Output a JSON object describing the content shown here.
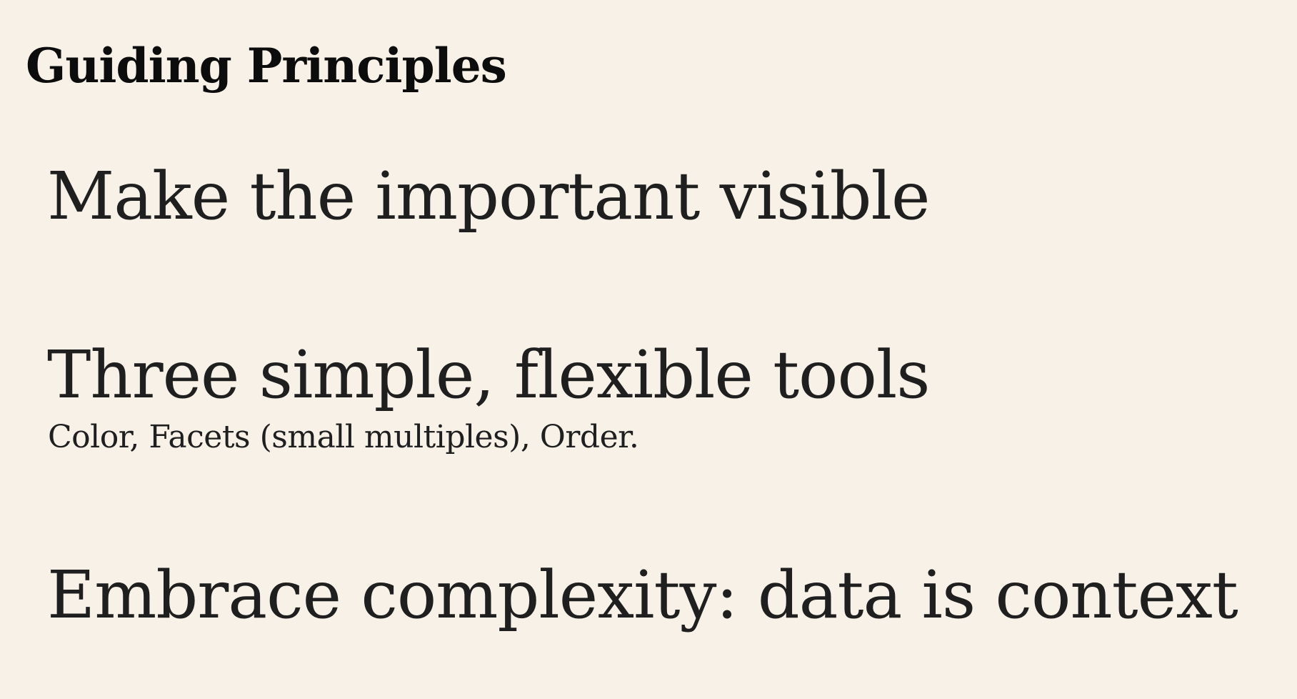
{
  "page": {
    "background": "#f7f1e8",
    "text_color": "#1f1f1f"
  },
  "heading": "Guiding Principles",
  "principles": [
    {
      "title": "Make the important visible",
      "detail": ""
    },
    {
      "title": "Three simple, flexible tools",
      "detail": "Color, Facets (small multiples), Order."
    },
    {
      "title": "Embrace complexity: data is context",
      "detail": ""
    }
  ]
}
